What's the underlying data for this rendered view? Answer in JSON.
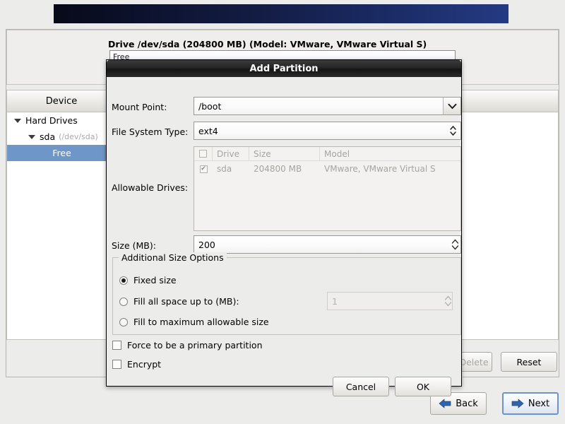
{
  "background": {
    "drive_title": "Drive /dev/sda (204800 MB) (Model: VMware, VMware Virtual S)",
    "partition_bar_label": "Free",
    "tree_header": "Device",
    "tree": [
      {
        "label": "Hard Drives",
        "sub": "",
        "depth": 0,
        "selected": false
      },
      {
        "label": "sda",
        "sub": "(/dev/sda)",
        "depth": 1,
        "selected": false
      },
      {
        "label": "Free",
        "sub": "",
        "depth": 2,
        "selected": true
      }
    ],
    "buttons": {
      "delete": "Delete",
      "reset": "Reset",
      "back": "Back",
      "next": "Next"
    }
  },
  "dialog": {
    "title": "Add Partition",
    "mount_point": {
      "label": "Mount Point:",
      "value": "/boot",
      "icon": "chevron-down-icon"
    },
    "file_system_type": {
      "label": "File System Type:",
      "value": "ext4",
      "icon": "spinner-updown-icon"
    },
    "allowable_drives": {
      "label": "Allowable Drives:",
      "columns": [
        "",
        "Drive",
        "Size",
        "Model"
      ],
      "rows": [
        {
          "checked": true,
          "drive": "sda",
          "size": "204800 MB",
          "model": "VMware, VMware Virtual S"
        }
      ]
    },
    "size": {
      "label": "Size (MB):",
      "value": "200"
    },
    "additional_size_options": {
      "legend": "Additional Size Options",
      "options": [
        {
          "label": "Fixed size",
          "selected": true
        },
        {
          "label": "Fill all space up to (MB):",
          "selected": false
        },
        {
          "label": "Fill to maximum allowable size",
          "selected": false
        }
      ],
      "fill_up_to_value": "1"
    },
    "checkboxes": [
      {
        "label": "Force to be a primary partition",
        "checked": false
      },
      {
        "label": "Encrypt",
        "checked": false
      }
    ],
    "buttons": {
      "cancel": "Cancel",
      "ok": "OK"
    }
  },
  "colors": {
    "selection_blue": "#6f96c8",
    "focus_blue": "#6a93cf",
    "banner_dark": "#080a18",
    "banner_light": "#243a82",
    "arrow_blue": "#2f63ab"
  }
}
